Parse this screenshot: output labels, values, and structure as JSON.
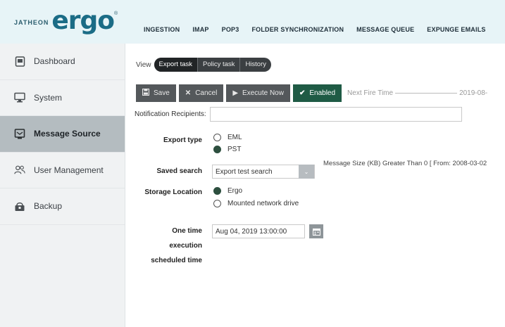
{
  "brand": {
    "prefix": "JATHEON",
    "name": "ergo"
  },
  "topnav": [
    "INGESTION",
    "IMAP",
    "POP3",
    "FOLDER SYNCHRONIZATION",
    "MESSAGE QUEUE",
    "EXPUNGE EMAILS"
  ],
  "sidebar": {
    "items": [
      {
        "label": "Dashboard",
        "icon": "dashboard-icon"
      },
      {
        "label": "System",
        "icon": "monitor-icon"
      },
      {
        "label": "Message Source",
        "icon": "message-source-icon",
        "active": true
      },
      {
        "label": "User Management",
        "icon": "users-icon"
      },
      {
        "label": "Backup",
        "icon": "backup-icon"
      }
    ]
  },
  "view": {
    "label": "View",
    "tabs": [
      "Export task",
      "Policy task",
      "History"
    ],
    "active_tab": "Export task"
  },
  "toolbar": {
    "save": "Save",
    "cancel": "Cancel",
    "execute": "Execute Now",
    "enabled": "Enabled",
    "next_fire_label": "Next Fire Time",
    "next_fire_value": "2019-08-"
  },
  "form": {
    "notification_label": "Notification Recipients:",
    "notification_value": "",
    "export_type_label": "Export type",
    "export_options": [
      "EML",
      "PST"
    ],
    "export_selected": "PST",
    "saved_search_label": "Saved search",
    "saved_search_value": "Export test search",
    "saved_search_info": "Message Size (KB) Greater Than 0 [ From: 2008-03-02",
    "storage_label": "Storage Location",
    "storage_options": [
      "Ergo",
      "Mounted network drive"
    ],
    "storage_selected": "Ergo",
    "schedule_label_1": "One time",
    "schedule_label_2": "execution",
    "schedule_label_3": "scheduled time",
    "schedule_value": "Aug 04, 2019 13:00:00"
  },
  "colors": {
    "accent": "#1b6c86",
    "enabled": "#1f5b45",
    "toolbar": "#54585b",
    "header_bg": "#e7f4f7"
  }
}
